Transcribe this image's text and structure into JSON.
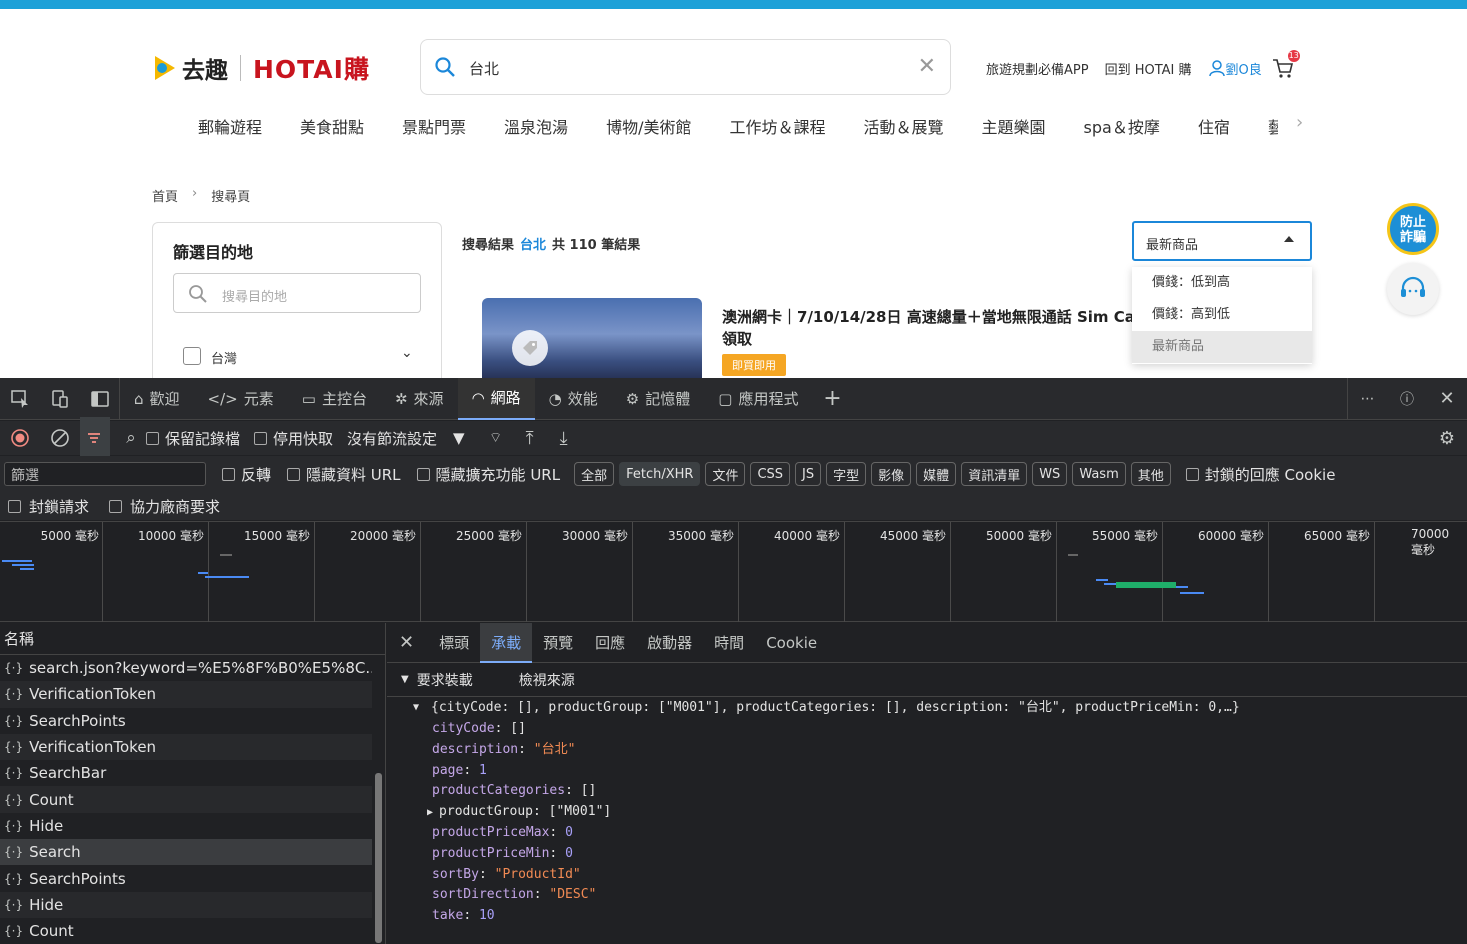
{
  "website": {
    "logo_quqi": "去趣",
    "logo_hotai": "HOTAI購",
    "search_value": "台北",
    "header_links": [
      "旅遊規劃必備APP",
      "回到 HOTAI 購"
    ],
    "user_name": "劉O良",
    "cart_count": "13",
    "categories": [
      "郵輪遊程",
      "美食甜點",
      "景點門票",
      "溫泉泡湯",
      "博物/美術館",
      "工作坊＆課程",
      "活動＆展覽",
      "主題樂園",
      "spa＆按摩",
      "住宿",
      "藝"
    ],
    "breadcrumb": [
      "首頁",
      "搜尋頁"
    ],
    "filter": {
      "title": "篩選目的地",
      "placeholder": "搜尋目的地",
      "option": "台灣"
    },
    "results": {
      "prefix": "搜尋結果",
      "keyword": "台北",
      "count_text": "共 110 筆結果"
    },
    "sort": {
      "selected": "最新商品",
      "options": [
        "價錢：低到高",
        "價錢：高到低",
        "最新商品"
      ]
    },
    "product": {
      "title": "澳洲網卡｜7/10/14/28日 高速總量＋當地無限通話 Sim Card",
      "title2": "領取",
      "tag": "即買即用"
    },
    "fab_fraud": "防止詐騙"
  },
  "devtools": {
    "tabs": [
      "歡迎",
      "元素",
      "主控台",
      "來源",
      "網路",
      "效能",
      "記憶體",
      "應用程式"
    ],
    "active_tab": "網路",
    "toolbar": {
      "preserve_log": "保留記錄檔",
      "disable_cache": "停用快取",
      "throttle": "沒有節流設定"
    },
    "filter": {
      "placeholder": "篩選",
      "invert": "反轉",
      "hide_data_url": "隱藏資料 URL",
      "hide_ext_url": "隱藏擴充功能 URL",
      "types": [
        "全部",
        "Fetch/XHR",
        "文件",
        "CSS",
        "JS",
        "字型",
        "影像",
        "媒體",
        "資訊清單",
        "WS",
        "Wasm",
        "其他"
      ],
      "active_type": "Fetch/XHR",
      "blocked_cookies": "封鎖的回應 Cookie"
    },
    "row3": {
      "blocked_requests": "封鎖請求",
      "third_party": "協力廠商要求"
    },
    "timeline_ticks": [
      "5000 毫秒",
      "10000 毫秒",
      "15000 毫秒",
      "20000 毫秒",
      "25000 毫秒",
      "30000 毫秒",
      "35000 毫秒",
      "40000 毫秒",
      "45000 毫秒",
      "50000 毫秒",
      "55000 毫秒",
      "60000 毫秒",
      "65000 毫秒",
      "70000 毫秒"
    ],
    "name_header": "名稱",
    "requests": [
      "search.json?keyword=%E5%8F%B0%E5%8C...",
      "VerificationToken",
      "SearchPoints",
      "VerificationToken",
      "SearchBar",
      "Count",
      "Hide",
      "Search",
      "SearchPoints",
      "Hide",
      "Count"
    ],
    "selected_request": "Search",
    "detail_tabs": [
      "標頭",
      "承載",
      "預覽",
      "回應",
      "啟動器",
      "時間",
      "Cookie"
    ],
    "active_detail_tab": "承載",
    "payload_header": "要求裝載",
    "view_source": "檢視來源",
    "payload_summary": "{cityCode: [], productGroup: [\"M001\"], productCategories: [], description: \"台北\", productPriceMin: 0,…}",
    "payload": [
      {
        "key": "cityCode",
        "value": "[]",
        "type": "plain"
      },
      {
        "key": "description",
        "value": "\"台北\"",
        "type": "string"
      },
      {
        "key": "page",
        "value": "1",
        "type": "number"
      },
      {
        "key": "productCategories",
        "value": "[]",
        "type": "plain"
      },
      {
        "key": "productGroup",
        "value": "[\"M001\"]",
        "type": "plain",
        "expandable": true
      },
      {
        "key": "productPriceMax",
        "value": "0",
        "type": "number"
      },
      {
        "key": "productPriceMin",
        "value": "0",
        "type": "number"
      },
      {
        "key": "sortBy",
        "value": "\"ProductId\"",
        "type": "string"
      },
      {
        "key": "sortDirection",
        "value": "\"DESC\"",
        "type": "string"
      },
      {
        "key": "take",
        "value": "10",
        "type": "number"
      }
    ]
  }
}
